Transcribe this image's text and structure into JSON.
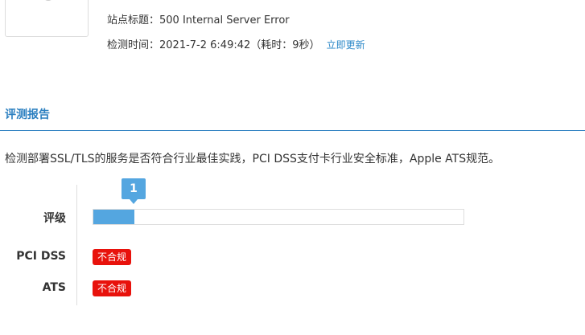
{
  "site": {
    "title_label": "站点标题：",
    "title_value": "500 Internal Server Error",
    "time_label": "检测时间：",
    "time_value": "2021-7-2 6:49:42",
    "duration_text": "（耗时：9秒）",
    "refresh_link": "立即更新"
  },
  "report": {
    "section_title": "评测报告",
    "description": "检测部署SSL/TLS的服务是否符合行业最佳实践，PCI DSS支付卡行业安全标准，Apple ATS规范。",
    "grade_label": "评级",
    "grade_value": "1",
    "grade_fill_fraction": 0.11,
    "pci_label": "PCI DSS",
    "pci_status": "不合规",
    "ats_label": "ATS",
    "ats_status": "不合规"
  },
  "colors": {
    "accent": "#2b7fc0",
    "bar": "#54a6e0",
    "fail": "#e8120c"
  }
}
